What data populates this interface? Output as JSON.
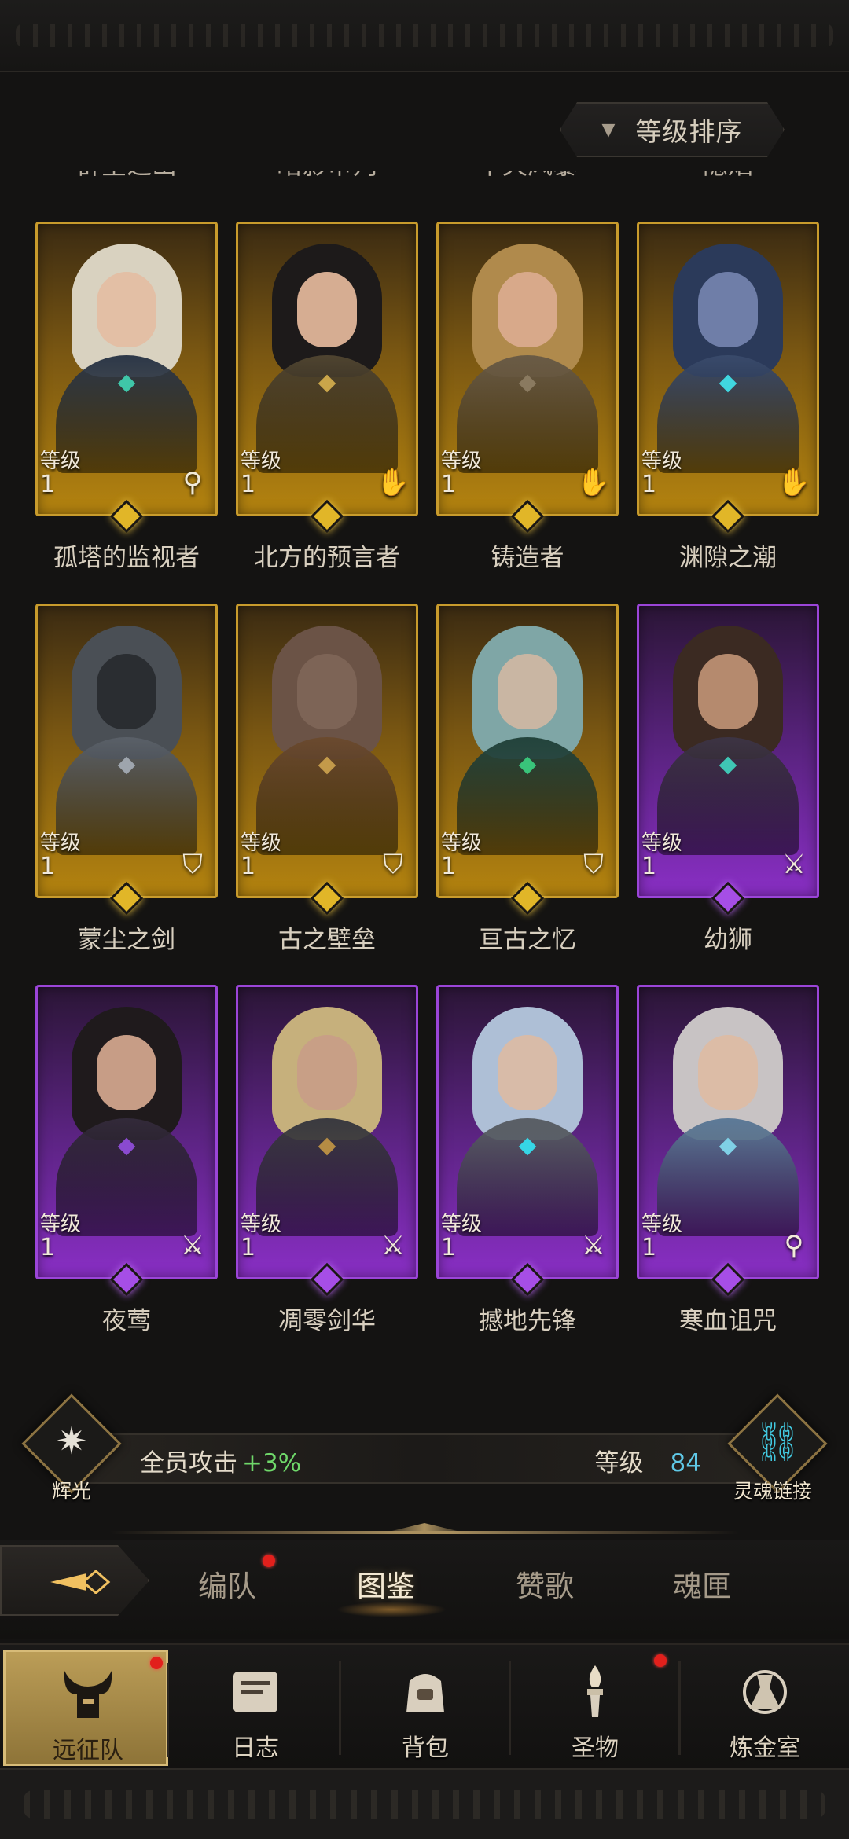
{
  "sort_button": {
    "label": "等级排序"
  },
  "cut_names": [
    "群星之山",
    "暗影审判",
    "不灭风暴",
    "隐焰"
  ],
  "heroes": [
    {
      "name": "孤塔的监视者",
      "level_label": "等级",
      "level": "1",
      "rarity": "gold",
      "role_icon": "staff-icon",
      "hair": "#d9d2c0",
      "face": "#e3bfa5",
      "body": "#2d3848",
      "gem": "#3fc6a8"
    },
    {
      "name": "北方的预言者",
      "level_label": "等级",
      "level": "1",
      "rarity": "gold",
      "role_icon": "palm-icon",
      "hair": "#1d1a1a",
      "face": "#d6ad92",
      "body": "#4f4430",
      "gem": "#c9a54a"
    },
    {
      "name": "铸造者",
      "level_label": "等级",
      "level": "1",
      "rarity": "gold",
      "role_icon": "palm-icon",
      "hair": "#b08a4c",
      "face": "#d8a98a",
      "body": "#6a5b45",
      "gem": "#8a7a60"
    },
    {
      "name": "渊隙之潮",
      "level_label": "等级",
      "level": "1",
      "rarity": "gold",
      "role_icon": "palm-icon",
      "hair": "#2b3a5a",
      "face": "#6f7ea8",
      "body": "#394a6b",
      "gem": "#40d7e0"
    },
    {
      "name": "蒙尘之剑",
      "level_label": "等级",
      "level": "1",
      "rarity": "gold",
      "role_icon": "shield-icon",
      "hair": "#4a4f55",
      "face": "#2a2d31",
      "body": "#5a6068",
      "gem": "#9ea5ad"
    },
    {
      "name": "古之壁垒",
      "level_label": "等级",
      "level": "1",
      "rarity": "gold",
      "role_icon": "shield-icon",
      "hair": "#6b5346",
      "face": "#7d6456",
      "body": "#6b4a2e",
      "gem": "#c39a4a"
    },
    {
      "name": "亘古之忆",
      "level_label": "等级",
      "level": "1",
      "rarity": "gold",
      "role_icon": "shield-icon",
      "hair": "#7fa6a6",
      "face": "#c9b6a3",
      "body": "#23443c",
      "gem": "#39c47a"
    },
    {
      "name": "幼狮",
      "level_label": "等级",
      "level": "1",
      "rarity": "purple",
      "role_icon": "sword-icon",
      "hair": "#3b2a22",
      "face": "#b58a6e",
      "body": "#3d3444",
      "gem": "#3fc6b4"
    },
    {
      "name": "夜莺",
      "level_label": "等级",
      "level": "1",
      "rarity": "purple",
      "role_icon": "sword-icon",
      "hair": "#1f1a1c",
      "face": "#c79d86",
      "body": "#332a3a",
      "gem": "#8a4ad0"
    },
    {
      "name": "凋零剑华",
      "level_label": "等级",
      "level": "1",
      "rarity": "purple",
      "role_icon": "sword-icon",
      "hair": "#c6b07c",
      "face": "#c89f86",
      "body": "#3a3a40",
      "gem": "#b68c44"
    },
    {
      "name": "撼地先锋",
      "level_label": "等级",
      "level": "1",
      "rarity": "purple",
      "role_icon": "sword-icon",
      "hair": "#aebfd6",
      "face": "#d8bba8",
      "body": "#5a5f66",
      "gem": "#36d6e6"
    },
    {
      "name": "寒血诅咒",
      "level_label": "等级",
      "level": "1",
      "rarity": "purple",
      "role_icon": "staff-icon",
      "hair": "#c8c3c4",
      "face": "#dcbca6",
      "body": "#5d7a98",
      "gem": "#7fd0e6"
    }
  ],
  "bonus": {
    "left_emblem": "辉光",
    "attack_label": "全员攻击",
    "attack_value": "+3%",
    "level_label": "等级",
    "level_value": "84",
    "right_emblem": "灵魂链接"
  },
  "tabs": [
    {
      "label": "编队",
      "active": false,
      "badge": true
    },
    {
      "label": "图鉴",
      "active": true,
      "badge": false
    },
    {
      "label": "赞歌",
      "active": false,
      "badge": false
    },
    {
      "label": "魂匣",
      "active": false,
      "badge": false
    }
  ],
  "nav": [
    {
      "label": "远征队",
      "icon": "horned-helmet-icon",
      "active": true,
      "badge": true
    },
    {
      "label": "日志",
      "icon": "scroll-icon",
      "active": false,
      "badge": false
    },
    {
      "label": "背包",
      "icon": "bag-icon",
      "active": false,
      "badge": false
    },
    {
      "label": "圣物",
      "icon": "torch-icon",
      "active": false,
      "badge": true
    },
    {
      "label": "炼金室",
      "icon": "alchemy-icon",
      "active": false,
      "badge": false
    }
  ],
  "colors": {
    "gold": "#c89b2c",
    "purple": "#9b45d8",
    "green": "#6fd86a",
    "cyan": "#5fc8e6",
    "badge": "#e2201c"
  }
}
